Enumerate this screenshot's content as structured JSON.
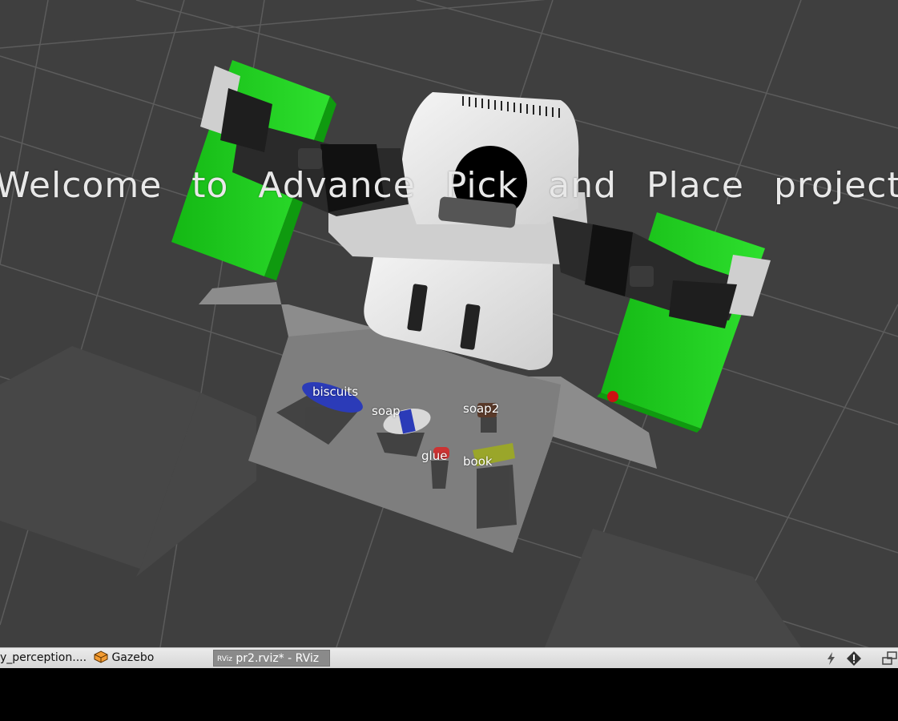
{
  "viewport": {
    "banner": "Welcome to Advance Pick and Place project",
    "object_labels": [
      {
        "name": "biscuits",
        "text": "biscuits"
      },
      {
        "name": "soap",
        "text": "soap"
      },
      {
        "name": "soap2",
        "text": "soap2"
      },
      {
        "name": "glue",
        "text": "glue"
      },
      {
        "name": "book",
        "text": "book"
      }
    ],
    "colors": {
      "background": "#3f3f3f",
      "grid": "#5a5a5a",
      "dropbox": "#22cc22",
      "robot_body": "#e6e6e6"
    }
  },
  "taskbar": {
    "items": [
      {
        "label": "y_perception....",
        "icon": "terminal-icon"
      },
      {
        "label": "Gazebo",
        "icon": "gazebo-icon"
      },
      {
        "label": "pr2.rviz* - RViz",
        "icon": "rviz-icon",
        "icon_text": "RViz",
        "active": true
      }
    ],
    "tray": [
      "power-icon",
      "alert-icon",
      "window-switch-icon"
    ]
  }
}
